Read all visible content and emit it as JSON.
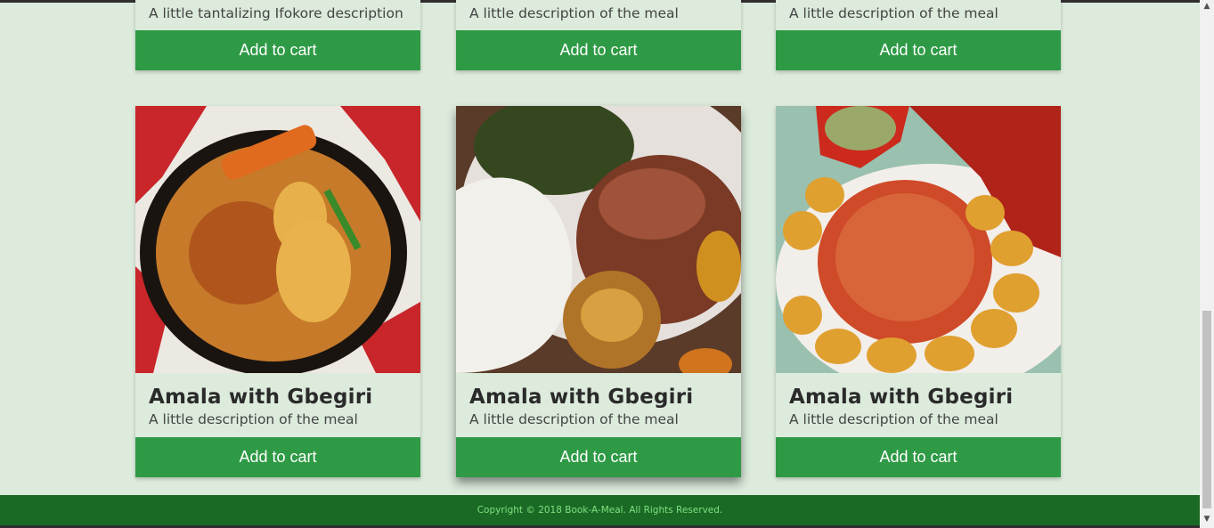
{
  "top_row": [
    {
      "description": "A little tantalizing Ifokore description",
      "button_label": "Add to cart"
    },
    {
      "description": "A little description of the meal",
      "button_label": "Add to cart"
    },
    {
      "description": "A little description of the meal",
      "button_label": "Add to cart"
    }
  ],
  "bottom_row": [
    {
      "title": "Amala with Gbegiri",
      "description": "A little description of the meal",
      "button_label": "Add to cart"
    },
    {
      "title": "Amala with Gbegiri",
      "description": "A little description of the meal",
      "button_label": "Add to cart"
    },
    {
      "title": "Amala with Gbegiri",
      "description": "A little description of the meal",
      "button_label": "Add to cart"
    }
  ],
  "footer": {
    "copyright": "Copyright © 2018 Book-A-Meal. All Rights Reserved."
  },
  "colors": {
    "page_background": "#dcebdc",
    "button": "#2e9a45",
    "button_text": "#ffffff",
    "footer_background": "#1a6a26",
    "footer_text": "#7fe07f"
  },
  "icons": {
    "scroll_up": "triangle-up-icon",
    "scroll_down": "triangle-down-icon"
  }
}
